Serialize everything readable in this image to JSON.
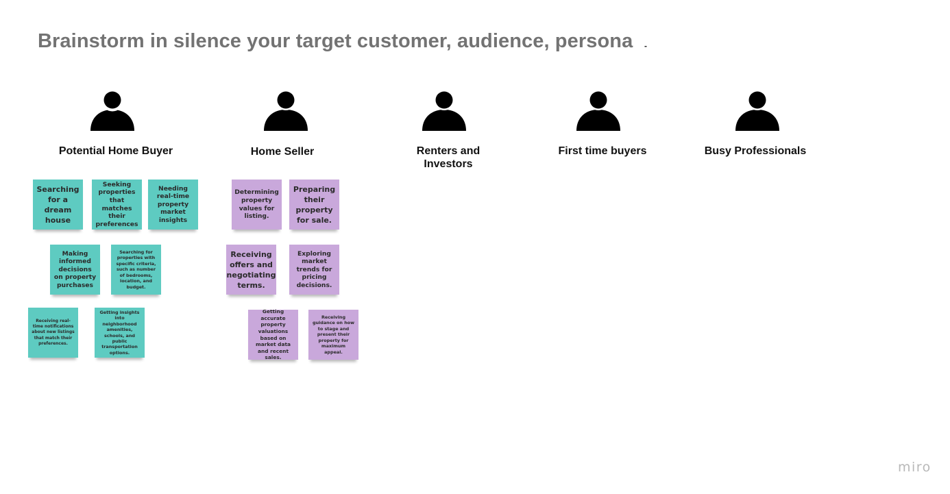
{
  "title": "Brainstorm in silence your target customer, audience, persona",
  "title_marker": "-",
  "colors": {
    "teal_note": "#5ecbc1",
    "purple_note": "#c9a8db",
    "title": "#737373"
  },
  "personas": [
    {
      "icon": "person-icon",
      "label": "Potential Home Buyer"
    },
    {
      "icon": "person-icon",
      "label": "Home Seller"
    },
    {
      "icon": "person-icon",
      "label": "Renters and Investors"
    },
    {
      "icon": "person-icon",
      "label": "First time buyers"
    },
    {
      "icon": "person-icon",
      "label": "Busy Professionals"
    }
  ],
  "buyer_notes": [
    "Searching for a dream house",
    "Seeking properties that matches their preferences",
    "Needing real-time property market insights",
    "Making informed decisions on property purchases",
    "Searching for properties with specific criteria, such as number of bedrooms, location, and budget.",
    "Receiving real-time notifications about new listings that match their preferences.",
    "Getting insights into neighborhood amenities, schools, and public transportation options."
  ],
  "seller_notes": [
    "Determining property values for listing.",
    "Preparing their property for sale.",
    "Receiving offers and negotiating terms.",
    "Exploring market trends for pricing decisions.",
    "Getting accurate property valuations based on market data and recent sales.",
    "Receiving guidance on how to stage and present their property for maximum appeal."
  ],
  "brand": "miro"
}
